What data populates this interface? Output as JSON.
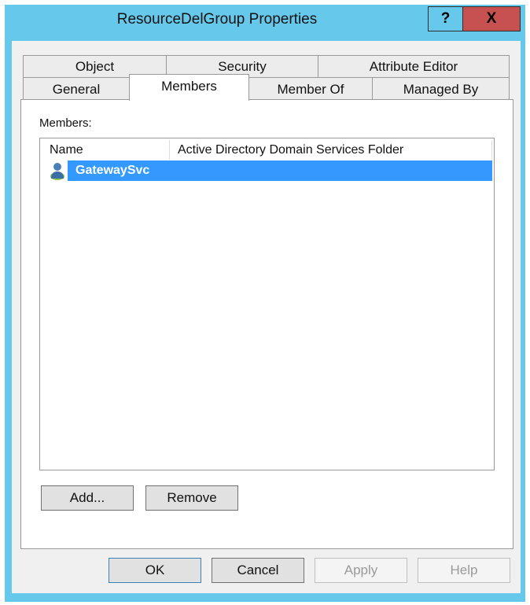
{
  "window": {
    "title": "ResourceDelGroup Properties",
    "help_label": "?",
    "close_label": "X"
  },
  "tabs_row1": [
    {
      "label": "Object"
    },
    {
      "label": "Security"
    },
    {
      "label": "Attribute Editor"
    }
  ],
  "tabs_row2": [
    {
      "label": "General"
    },
    {
      "label": "Members",
      "selected": true
    },
    {
      "label": "Member Of"
    },
    {
      "label": "Managed By"
    }
  ],
  "members": {
    "label": "Members:",
    "columns": [
      "Name",
      "Active Directory Domain Services Folder"
    ],
    "rows": [
      {
        "name": "GatewaySvc",
        "folder": "",
        "icon": "user-icon",
        "selected": true
      }
    ],
    "add_label": "Add...",
    "remove_label": "Remove"
  },
  "footer": {
    "ok": "OK",
    "cancel": "Cancel",
    "apply": "Apply",
    "help": "Help"
  },
  "colors": {
    "frame": "#66c9ec",
    "close": "#c75050",
    "selection": "#3399ff"
  }
}
